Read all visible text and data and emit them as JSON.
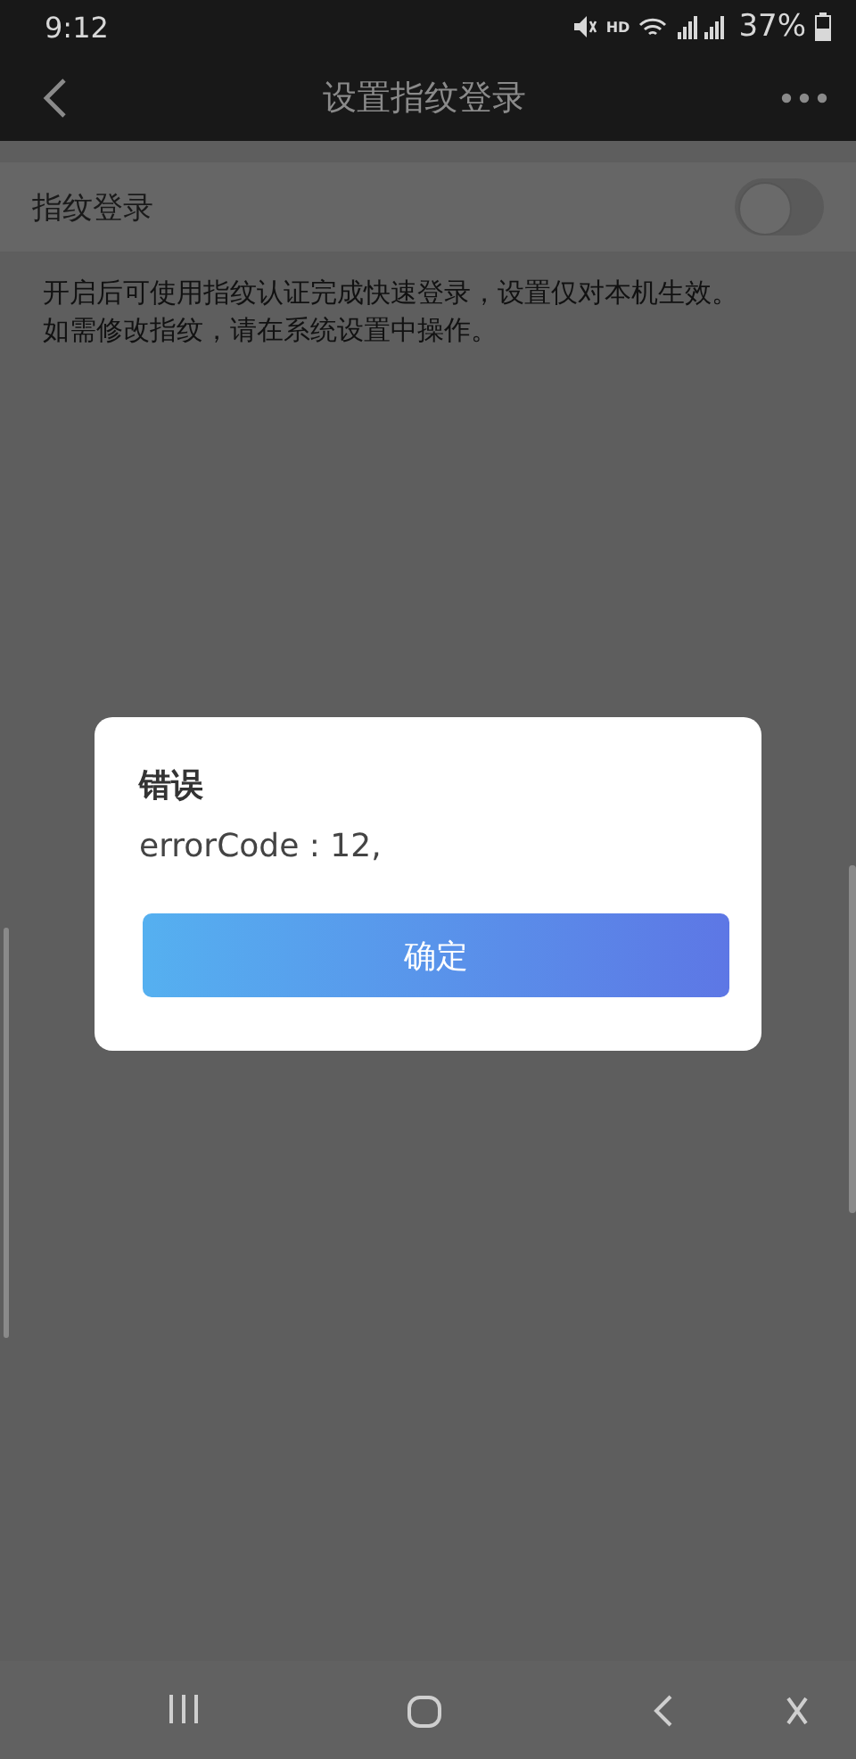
{
  "status_bar": {
    "time": "9:12",
    "network_label": "HD",
    "battery": "37%"
  },
  "header": {
    "title": "设置指纹登录"
  },
  "settings": {
    "label": "指纹登录",
    "on": false,
    "description_lines": [
      "开启后可使用指纹认证完成快速登录，设置仅对本机生效。",
      "如需修改指纹，请在系统设置中操作。"
    ]
  },
  "dialog": {
    "title": "错误",
    "message": "errorCode : 12,",
    "button": "确定"
  }
}
